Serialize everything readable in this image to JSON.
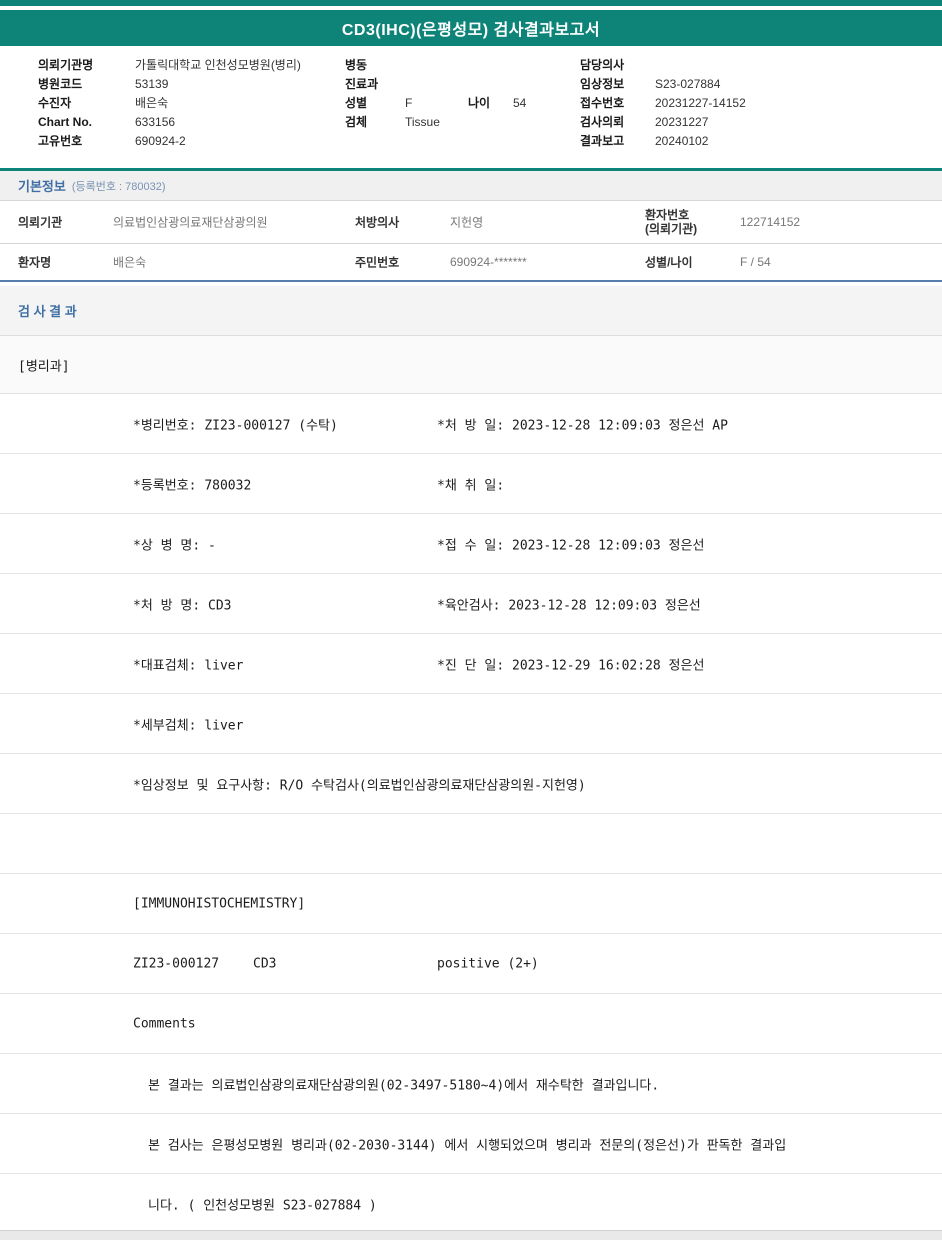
{
  "theme": {
    "teal": "#0e8479",
    "blue": "#3f6fa5",
    "divider": "#567fb0"
  },
  "report": {
    "title": "CD3(IHC)(은평성모) 검사결과보고서"
  },
  "header": {
    "left": [
      {
        "label": "의뢰기관명",
        "value": "가톨릭대학교 인천성모병원(병리)"
      },
      {
        "label": "병원코드",
        "value": "53139"
      },
      {
        "label": "수진자",
        "value": "배은숙"
      },
      {
        "label": "Chart No.",
        "value": "633156"
      },
      {
        "label": "고유번호",
        "value": "690924-2"
      }
    ],
    "middle": [
      {
        "label": "병동",
        "value": ""
      },
      {
        "label": "진료과",
        "value": ""
      },
      {
        "label": "성별",
        "value": "F"
      },
      {
        "label": "검체",
        "value": "Tissue"
      }
    ],
    "age": {
      "label": "나이",
      "value": "54"
    },
    "right": [
      {
        "label": "담당의사",
        "value": ""
      },
      {
        "label": "임상정보",
        "value": "S23-027884"
      },
      {
        "label": "접수번호",
        "value": "20231227-14152"
      },
      {
        "label": "검사의뢰",
        "value": "20231227"
      },
      {
        "label": "결과보고",
        "value": "20240102"
      }
    ]
  },
  "basic_info": {
    "title": "기본정보",
    "subtitle": "(등록번호 : 780032)",
    "row1": {
      "c1_label": "의뢰기관",
      "c1_value": "의료법인삼광의료재단삼광의원",
      "c2_label": "처방의사",
      "c2_value": "지헌영",
      "c3_label": "환자번호\n(의뢰기관)",
      "c3_value": "122714152"
    },
    "row2": {
      "c1_label": "환자명",
      "c1_value": "배은숙",
      "c2_label": "주민번호",
      "c2_value": "690924-*******",
      "c3_label": "성별/나이",
      "c3_value": "F / 54"
    }
  },
  "results": {
    "title": "검 사 결 과",
    "department": "[병리과]",
    "rows": [
      {
        "left": "*병리번호: ZI23-000127 (수탁)",
        "right": "*처 방 일: 2023-12-28 12:09:03 정은선 AP"
      },
      {
        "left": "*등록번호: 780032",
        "right": "*채 취 일:"
      },
      {
        "left": "*상 병 명: -",
        "right": "*접 수 일: 2023-12-28 12:09:03 정은선"
      },
      {
        "left": "*처 방 명: CD3",
        "right": "*육안검사: 2023-12-28 12:09:03 정은선"
      },
      {
        "left": "*대표검체: liver",
        "right": "*진 단 일: 2023-12-29 16:02:28 정은선"
      },
      {
        "left": "*세부검체: liver",
        "right": ""
      },
      {
        "left": "*임상정보 및 요구사항: R/O 수탁검사(의료법인삼광의료재단삼광의원-지헌영)",
        "right": ""
      },
      {
        "left": "",
        "right": ""
      },
      {
        "left": "[IMMUNOHISTOCHEMISTRY]",
        "right": ""
      },
      {
        "left": "ZI23-000127",
        "mid": "CD3",
        "right": "positive (2+)"
      },
      {
        "left": "Comments",
        "right": ""
      },
      {
        "left": "본 결과는 의료법인삼광의료재단삼광의원(02-3497-5180~4)에서 재수탁한 결과입니다.",
        "right": ""
      },
      {
        "left": "본 검사는 은평성모병원 병리과(02-2030-3144) 에서 시행되었으며 병리과 전문의(정은선)가 판독한 결과입",
        "right": ""
      },
      {
        "left": "니다. ( 인천성모병원 S23-027884 )",
        "right": ""
      }
    ]
  }
}
